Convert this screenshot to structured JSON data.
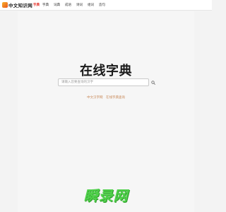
{
  "header": {
    "logo_text": "中文知识网",
    "logo_sub": "字典",
    "nav": [
      {
        "label": "字典"
      },
      {
        "label": "词典"
      },
      {
        "label": "成语"
      },
      {
        "label": "诗词"
      },
      {
        "label": "组词"
      },
      {
        "label": "造句"
      }
    ]
  },
  "main": {
    "title": "在线字典",
    "search": {
      "value": "",
      "placeholder": "请输入您要查询的汉字"
    },
    "hints": [
      "中文汉字网",
      "在线字典查询"
    ]
  },
  "watermark": {
    "text": "瞬录网"
  },
  "colors": {
    "background": "#f3f3f3",
    "hint": "#c98a5a",
    "watermark": "#4fd04a",
    "logo_accent": "#e2231a"
  }
}
